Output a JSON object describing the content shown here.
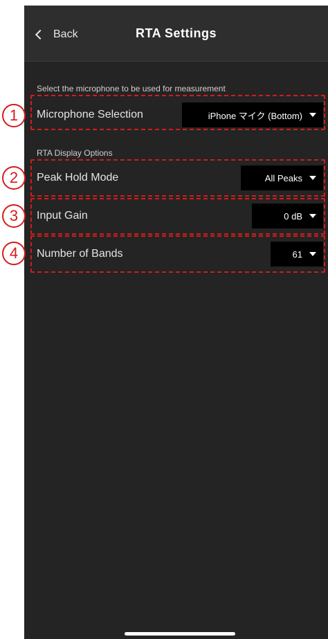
{
  "nav": {
    "back_label": "Back",
    "title": "RTA Settings"
  },
  "sections": {
    "microphone_caption": "Select the microphone to be used for measurement",
    "display_caption": "RTA Display Options"
  },
  "settings": [
    {
      "badge": "1",
      "label": "Microphone Selection",
      "value": "iPhone マイク (Bottom)"
    },
    {
      "badge": "2",
      "label": "Peak Hold Mode",
      "value": "All Peaks"
    },
    {
      "badge": "3",
      "label": "Input Gain",
      "value": "0 dB"
    },
    {
      "badge": "4",
      "label": "Number of Bands",
      "value": "61"
    }
  ],
  "icons": {
    "back": "chevron-left-icon",
    "dropdown": "caret-down-icon"
  },
  "colors": {
    "background": "#242424",
    "nav_bar": "#2e2e2e",
    "select_bg": "#000000",
    "annotation": "#d51b1b",
    "text": "#e4e4e4"
  }
}
